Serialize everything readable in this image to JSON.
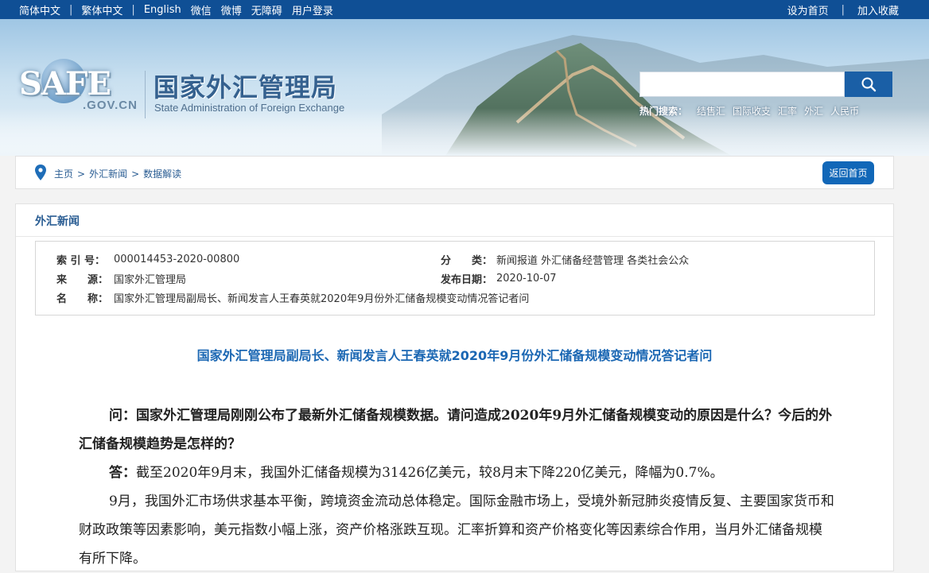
{
  "topbar": {
    "lang_simplified": "简体中文",
    "lang_traditional": "繁体中文",
    "lang_english": "English",
    "wechat": "微信",
    "weibo": "微博",
    "accessible": "无障碍",
    "login": "用户登录",
    "set_home": "设为首页",
    "add_favorite": "加入收藏"
  },
  "header": {
    "logo_text": "SAFE",
    "logo_domain": ".GOV.CN",
    "org_name_cn": "国家外汇管理局",
    "org_name_en": "State Administration of Foreign Exchange",
    "search_icon": "search-icon",
    "hot_label": "热门搜索：",
    "hot_keywords": [
      "结售汇",
      "国际收支",
      "汇率",
      "外汇",
      "人民币"
    ]
  },
  "breadcrumb": {
    "icon": "location-pin-icon",
    "items": [
      "主页",
      "外汇新闻",
      "数据解读"
    ],
    "separator": ">",
    "home_button": "返回首页"
  },
  "section": {
    "title": "外汇新闻"
  },
  "meta": {
    "index_label": "索 引 号：",
    "index_value": "000014453-2020-00800",
    "category_label": "分　　类：",
    "category_value": "新闻报道  外汇储备经营管理  各类社会公众",
    "source_label": "来　　源：",
    "source_value": "国家外汇管理局",
    "date_label": "发布日期：",
    "date_value": "2020-10-07",
    "name_label": "名　　称：",
    "name_value": "国家外汇管理局副局长、新闻发言人王春英就2020年9月份外汇储备规模变动情况答记者问"
  },
  "article": {
    "title": "国家外汇管理局副局长、新闻发言人王春英就2020年9月份外汇储备规模变动情况答记者问",
    "question": "问：国家外汇管理局刚刚公布了最新外汇储备规模数据。请问造成2020年9月外汇储备规模变动的原因是什么？今后的外汇储备规模趋势是怎样的？",
    "answer_label": "答：",
    "answer_text": "截至2020年9月末，我国外汇储备规模为31426亿美元，较8月末下降220亿美元，降幅为0.7%。",
    "paragraph": "9月，我国外汇市场供求基本平衡，跨境资金流动总体稳定。国际金融市场上，受境外新冠肺炎疫情反复、主要国家货币和财政政策等因素影响，美元指数小幅上涨，资产价格涨跌互现。汇率折算和资产价格变化等因素综合作用，当月外汇储备规模有所下降。"
  },
  "colors": {
    "topbar": "#0f4f95",
    "link": "#2a5d93",
    "title": "#1b67b3",
    "button": "#1167b8"
  }
}
